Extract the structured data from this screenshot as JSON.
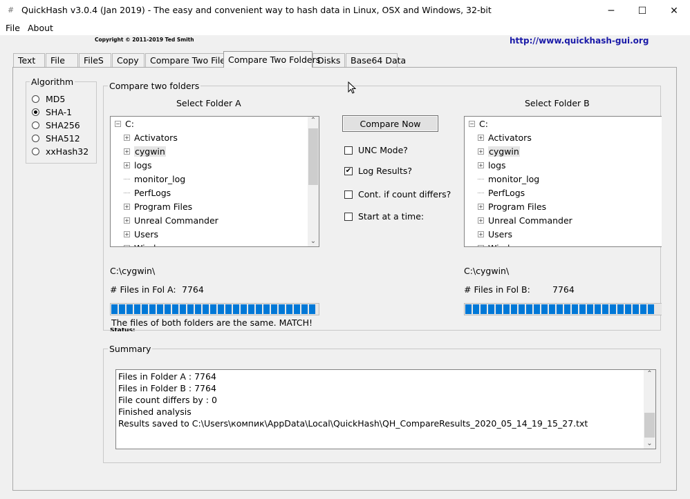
{
  "window": {
    "title": "QuickHash v3.0.4 (Jan 2019) - The easy and convenient way to hash data in Linux, OSX and Windows, 32-bit",
    "minimize": "─",
    "maximize": "☐",
    "close": "✕"
  },
  "menu": {
    "file": "File",
    "about": "About"
  },
  "header": {
    "copyright": "Copyright © 2011-2019  Ted Smith",
    "url": "http://www.quickhash-gui.org"
  },
  "tabs": [
    {
      "label": "Text"
    },
    {
      "label": "File"
    },
    {
      "label": "FileS"
    },
    {
      "label": "Copy"
    },
    {
      "label": "Compare Two Files"
    },
    {
      "label": "Compare Two Folders"
    },
    {
      "label": "Disks"
    },
    {
      "label": "Base64 Data"
    }
  ],
  "active_tab": "Compare Two Folders",
  "algorithm": {
    "title": "Algorithm",
    "options": [
      {
        "label": "MD5",
        "selected": false
      },
      {
        "label": "SHA-1",
        "selected": true
      },
      {
        "label": "SHA256",
        "selected": false
      },
      {
        "label": "SHA512",
        "selected": false
      },
      {
        "label": "xxHash32",
        "selected": false
      }
    ]
  },
  "compare": {
    "group_title": "Compare two folders",
    "folder_a_label": "Select Folder A",
    "folder_b_label": "Select Folder B",
    "tree_items": [
      {
        "label": "C:",
        "expander": "−",
        "selected": false
      },
      {
        "label": "Activators",
        "expander": "+",
        "selected": false
      },
      {
        "label": "cygwin",
        "expander": "+",
        "selected": true
      },
      {
        "label": "logs",
        "expander": "+",
        "selected": false
      },
      {
        "label": "monitor_log",
        "expander": "",
        "selected": false
      },
      {
        "label": "PerfLogs",
        "expander": "",
        "selected": false
      },
      {
        "label": "Program Files",
        "expander": "+",
        "selected": false
      },
      {
        "label": "Unreal Commander",
        "expander": "+",
        "selected": false
      },
      {
        "label": "Users",
        "expander": "+",
        "selected": false
      },
      {
        "label": "Windows",
        "expander": "+",
        "selected": false
      }
    ],
    "compare_button": "Compare Now",
    "options": [
      {
        "label": "UNC Mode?",
        "checked": false
      },
      {
        "label": "Log Results?",
        "checked": true
      },
      {
        "label": "Cont. if count differs?",
        "checked": false
      },
      {
        "label": "Start at a time:",
        "checked": false
      }
    ],
    "path_a": "C:\\cygwin\\",
    "path_b": "C:\\cygwin\\",
    "files_a_label": "# Files in Fol A:",
    "files_a_value": "7764",
    "files_b_label": "# Files in Fol B:",
    "files_b_value": "7764",
    "progress_a": 1.0,
    "progress_b": 1.0,
    "result_text": "The files of both folders are the same. MATCH!",
    "status_label": "Status:"
  },
  "summary": {
    "title": "Summary",
    "lines": [
      "Files in Folder A : 7764",
      "Files in Folder B : 7764",
      "File count differs by : 0",
      "Finished analysis",
      "Results saved to C:\\Users\\компик\\AppData\\Local\\QuickHash\\QH_CompareResults_2020_05_14_19_15_27.txt"
    ]
  },
  "icons": {
    "check": "✔",
    "up": "⌃",
    "down": "⌄"
  }
}
